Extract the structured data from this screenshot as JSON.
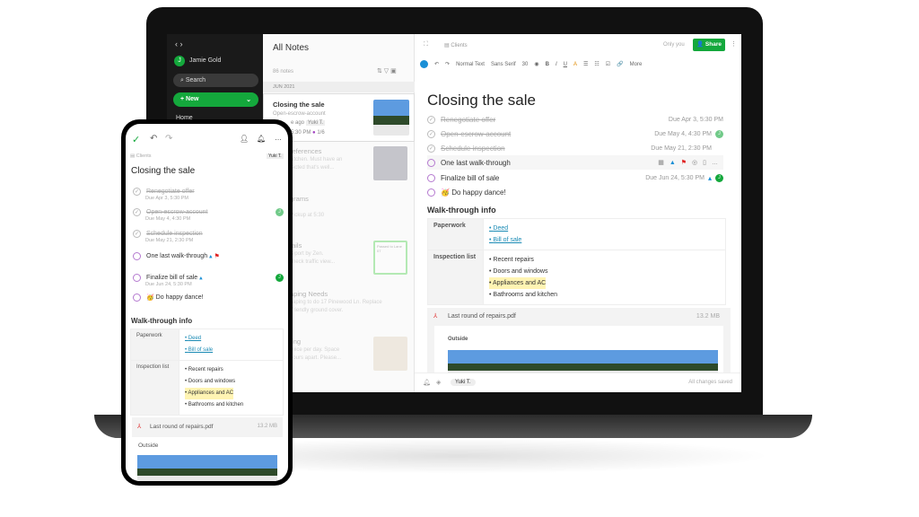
{
  "sidebar": {
    "user": "Jamie Gold",
    "user_initial": "J",
    "search": "Search",
    "new": "New",
    "home": "Home"
  },
  "notes": {
    "title": "All Notes",
    "count": "86 notes",
    "month": "JUN 2021",
    "items": [
      {
        "title": "Closing the sale",
        "snippet": "Open-escrow-account",
        "meta": "e ago",
        "tag": "Yuki T.",
        "time": "5:30 PM",
        "progress": "1/6"
      },
      {
        "title": "references",
        "snippet": "kitchen. Must have an",
        "snippet2": "racted that's well..."
      },
      {
        "title": "grams",
        "snippet": "Pickup at 5:30"
      },
      {
        "title": "tails",
        "snippet": "report by Zen.",
        "snippet2": "check traffic view..."
      },
      {
        "title": "aping Needs",
        "snippet": "caping to do 17 Pinewood Ln. Replace",
        "snippet2": "-friendly ground cover."
      },
      {
        "title": "ting",
        "snippet": "twice per day. Space",
        "snippet2": "hours apart. Please..."
      }
    ],
    "ticket": "Passed to Lane 07"
  },
  "editor": {
    "notebook": "Clients",
    "visibility": "Only you",
    "share": "Share",
    "toolbar": {
      "style": "Normal Text",
      "font": "Sans Serif",
      "size": "30",
      "more": "More"
    },
    "title": "Closing the sale",
    "tasks": [
      {
        "label": "Renegotiate offer",
        "due": "Due Apr 3, 5:30 PM",
        "done": true
      },
      {
        "label": "Open-escrow-account",
        "due": "Due May 4, 4:30 PM",
        "done": true
      },
      {
        "label": "Schedule inspection",
        "due": "Due May 21, 2:30 PM",
        "done": true
      },
      {
        "label": "One last walk-through",
        "due": "",
        "done": false
      },
      {
        "label": "Finalize bill of sale",
        "due": "Due Jun 24, 5:30 PM",
        "done": false
      },
      {
        "label": "Do happy dance!",
        "due": "",
        "done": false
      }
    ],
    "section": "Walk-through info",
    "table": {
      "paperwork": "Paperwork",
      "paperwork_items": [
        "Deed",
        "Bill of sale"
      ],
      "inspection": "Inspection list",
      "inspection_items": [
        "Recent repairs",
        "Doors and windows",
        "Appliances and AC",
        "Bathrooms and kitchen"
      ]
    },
    "attachment": {
      "name": "Last round of repairs.pdf",
      "size": "13.2 MB",
      "caption": "Outside"
    },
    "footer": {
      "assignee": "Yuki T.",
      "status": "All changes saved"
    }
  },
  "phone": {
    "notebook": "Clients",
    "tag": "Yuki T.",
    "title": "Closing the sale",
    "tasks": [
      {
        "label": "Renegotiate offer",
        "due": "Due Apr 3, 5:30 PM"
      },
      {
        "label": "Open-escrow-account",
        "due": "Due May 4, 4:30 PM"
      },
      {
        "label": "Schedule inspection",
        "due": "Due May 21, 2:30 PM"
      },
      {
        "label": "One last walk-through",
        "due": ""
      },
      {
        "label": "Finalize bill of sale",
        "due": "Due Jun 24, 5:30 PM"
      },
      {
        "label": "Do happy dance!",
        "due": ""
      }
    ]
  },
  "colors": {
    "accent": "#14a83c",
    "link": "#1b8bb5",
    "highlight": "#fff4b3",
    "sidebar": "#1a1a1a"
  }
}
